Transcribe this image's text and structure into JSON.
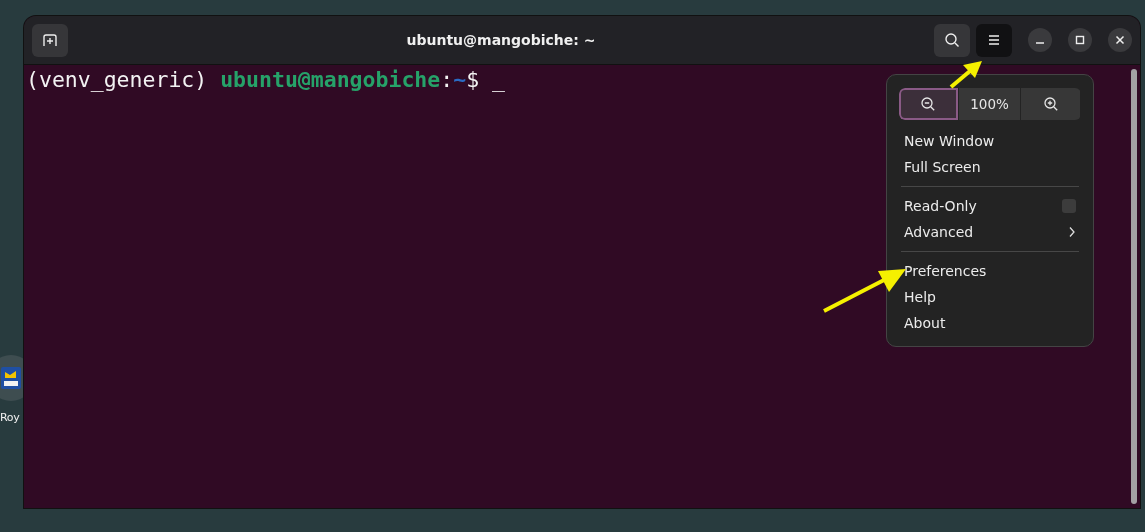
{
  "desktop_icons": [
    {
      "label": "Roy"
    }
  ],
  "window": {
    "title": "ubuntu@mangobiche: ~"
  },
  "header_buttons": [
    {
      "kind": "new-tab",
      "pressed": false
    },
    {
      "kind": "search",
      "pressed": false
    },
    {
      "kind": "menu",
      "pressed": true
    },
    {
      "kind": "minimize",
      "pressed": false
    },
    {
      "kind": "maximize",
      "pressed": false
    },
    {
      "kind": "close",
      "pressed": false
    }
  ],
  "terminal": {
    "lines": [
      {
        "segments": [
          {
            "kind": "plain",
            "text": "(venv_generic) "
          },
          {
            "kind": "user",
            "text": "ubuntu@mangobiche"
          },
          {
            "kind": "plain",
            "text": ":"
          },
          {
            "kind": "path",
            "text": "~"
          },
          {
            "kind": "plain",
            "text": "$ "
          },
          {
            "kind": "cursor",
            "text": "_"
          }
        ]
      }
    ]
  },
  "menu": {
    "zoom": [
      {
        "kind": "zoom-out",
        "focused": true
      },
      {
        "kind": "level",
        "label": "100%",
        "focused": false
      },
      {
        "kind": "zoom-in",
        "focused": false
      }
    ],
    "sections": [
      [
        {
          "kind": "item",
          "label": "New Window"
        },
        {
          "kind": "item",
          "label": "Full Screen"
        }
      ],
      [
        {
          "kind": "check",
          "label": "Read-Only",
          "checked": false
        },
        {
          "kind": "submenu",
          "label": "Advanced"
        }
      ],
      [
        {
          "kind": "item",
          "label": "Preferences"
        },
        {
          "kind": "item",
          "label": "Help"
        },
        {
          "kind": "item",
          "label": "About"
        }
      ]
    ]
  }
}
